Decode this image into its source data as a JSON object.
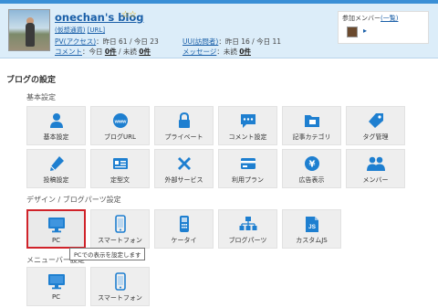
{
  "header": {
    "blog_name": "onechan's blog",
    "stars": "☆☆",
    "sub_link": "(仮想通貨)",
    "url_link": "[URL]",
    "pv_label": "PV(アクセス)",
    "pv_value": "：昨日 61 / 今日 23",
    "uu_label": "UU(訪問者)",
    "uu_value": "：昨日 16 / 今日 11",
    "comment_label": "コメント",
    "comment_prefix": "：今日",
    "comment_today": "0件",
    "comment_mid": " / 未読",
    "comment_unread": "0件",
    "message_label": "メッセージ",
    "message_prefix": "：未読",
    "message_unread": "0件",
    "members_label": "参加メンバー",
    "members_link": "(一覧)",
    "members_arrow": "▸"
  },
  "settings": {
    "title": "ブログの設定",
    "basic_title": "基本設定",
    "basic_tiles": [
      {
        "label": "基本設定",
        "icon": "person-icon"
      },
      {
        "label": "ブログURL",
        "icon": "www-globe-icon"
      },
      {
        "label": "プライベート",
        "icon": "lock-icon"
      },
      {
        "label": "コメント設定",
        "icon": "speech-bubble-icon"
      },
      {
        "label": "記事カテゴリ",
        "icon": "folder-icon"
      },
      {
        "label": "タグ管理",
        "icon": "tag-icon"
      },
      {
        "label": "投稿設定",
        "icon": "pen-icon"
      },
      {
        "label": "定型文",
        "icon": "template-card-icon"
      },
      {
        "label": "外部サービス",
        "icon": "tools-cross-icon"
      },
      {
        "label": "利用プラン",
        "icon": "card-icon"
      },
      {
        "label": "広告表示",
        "icon": "yen-coin-icon"
      },
      {
        "label": "メンバー",
        "icon": "group-icon"
      }
    ],
    "design_title": "デザイン / ブログパーツ設定",
    "design_tiles": [
      {
        "label": "PC",
        "icon": "monitor-icon"
      },
      {
        "label": "スマートフォン",
        "icon": "smartphone-icon"
      },
      {
        "label": "ケータイ",
        "icon": "feature-phone-icon"
      },
      {
        "label": "ブログパーツ",
        "icon": "parts-tree-icon"
      },
      {
        "label": "カスタムJS",
        "icon": "js-file-icon"
      }
    ],
    "menu_title": "メニューバー設定",
    "menu_tiles": [
      {
        "label": "PC",
        "icon": "monitor-icon"
      },
      {
        "label": "スマートフォン",
        "icon": "smartphone-icon"
      }
    ],
    "tooltip": "PCでの表示を設定します"
  },
  "colors": {
    "accent": "#1e7fd0",
    "selected_border": "#d0232a",
    "header_bg": "#dcedf9"
  }
}
